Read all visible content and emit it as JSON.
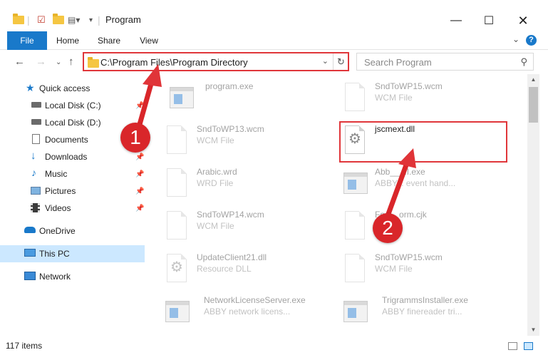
{
  "window": {
    "title": "Program"
  },
  "ribbon": {
    "tabs": [
      "File",
      "Home",
      "Share",
      "View"
    ],
    "help": "?"
  },
  "address": {
    "path": "C:\\Program Files\\Program Directory"
  },
  "search": {
    "placeholder": "Search Program"
  },
  "sidebar": {
    "items": [
      {
        "label": "Quick access",
        "icon": "star-icon"
      },
      {
        "label": "Local Disk (C:)",
        "icon": "drive-icon",
        "pinned": true
      },
      {
        "label": "Local Disk (D:)",
        "icon": "drive-icon",
        "pinned": false
      },
      {
        "label": "Documents",
        "icon": "documents-icon",
        "pinned": true
      },
      {
        "label": "Downloads",
        "icon": "download-icon",
        "pinned": true
      },
      {
        "label": "Music",
        "icon": "music-icon",
        "pinned": true
      },
      {
        "label": "Pictures",
        "icon": "pictures-icon",
        "pinned": true
      },
      {
        "label": "Videos",
        "icon": "videos-icon",
        "pinned": true
      },
      {
        "label": "OneDrive",
        "icon": "cloud-icon"
      },
      {
        "label": "This PC",
        "icon": "computer-icon",
        "selected": true
      },
      {
        "label": "Network",
        "icon": "network-icon"
      }
    ]
  },
  "files": [
    {
      "name": "program.exe",
      "type": "",
      "icon": "installer-icon"
    },
    {
      "name": "SndToWP15.wcm",
      "type": "WCM File",
      "icon": "document-icon"
    },
    {
      "name": "SndToWP13.wcm",
      "type": "WCM File",
      "icon": "document-icon"
    },
    {
      "name": "jscmext.dll",
      "type": "",
      "icon": "dll-gears-icon",
      "highlighted": true
    },
    {
      "name": "Arabic.wrd",
      "type": "WRD File",
      "icon": "document-icon"
    },
    {
      "name": "Abb___II.exe",
      "type": "ABBY... event hand...",
      "icon": "application-icon"
    },
    {
      "name": "SndToWP14.wcm",
      "type": "WCM File",
      "icon": "document-icon"
    },
    {
      "name": "Fo___orm.cjk",
      "type": "",
      "icon": "document-icon"
    },
    {
      "name": "UpdateClient21.dll",
      "type": "Resource DLL",
      "icon": "dll-gears-icon"
    },
    {
      "name": "SndToWP15.wcm",
      "type": "WCM File",
      "icon": "document-icon"
    },
    {
      "name": "NetworkLicenseServer.exe",
      "type": "ABBY network licens...",
      "icon": "application-icon"
    },
    {
      "name": "TrigrammsInstaller.exe",
      "type": "ABBY finereader tri...",
      "icon": "application-icon"
    }
  ],
  "status": {
    "item_count": "117 items"
  },
  "annotations": {
    "step1": "1",
    "step2": "2"
  },
  "colors": {
    "accent": "#1979ca",
    "highlight": "#e0363a",
    "selected": "#cce8ff"
  }
}
